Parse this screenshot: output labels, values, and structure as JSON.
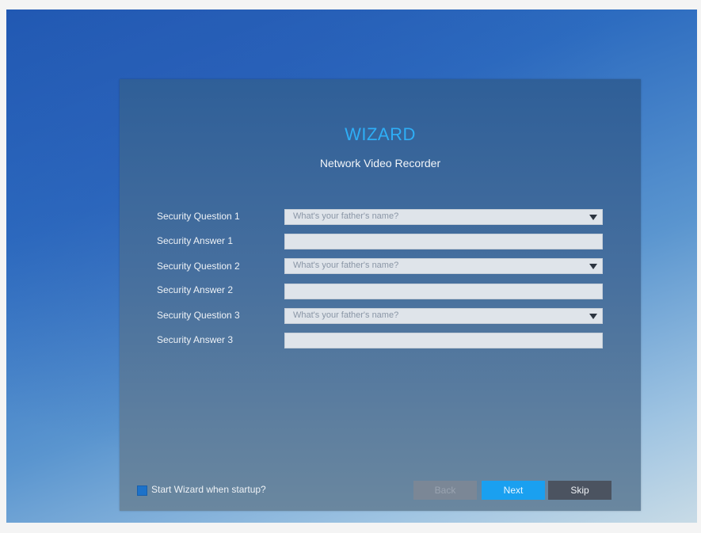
{
  "wizard": {
    "title": "WIZARD",
    "subtitle": "Network Video Recorder"
  },
  "security": {
    "question1_label": "Security Question 1",
    "question1_value": "What's your father's name?",
    "answer1_label": "Security Answer 1",
    "answer1_value": "",
    "question2_label": "Security Question 2",
    "question2_value": "What's your father's name?",
    "answer2_label": "Security Answer 2",
    "answer2_value": "",
    "question3_label": "Security Question 3",
    "question3_value": "What's your father's name?",
    "answer3_label": "Security Answer 3",
    "answer3_value": ""
  },
  "footer": {
    "startup_checkbox_label": "Start Wizard when startup?",
    "startup_checked": true,
    "back_label": "Back",
    "next_label": "Next",
    "skip_label": "Skip"
  },
  "colors": {
    "accent": "#2eaef6",
    "next_button": "#1aa0f0",
    "skip_button": "#4b5360",
    "back_button_disabled": "#7b8796",
    "checkbox": "#1d72c9"
  },
  "icons": {
    "dropdown": "chevron-down-icon",
    "checkbox": "checkbox-checked-icon"
  }
}
